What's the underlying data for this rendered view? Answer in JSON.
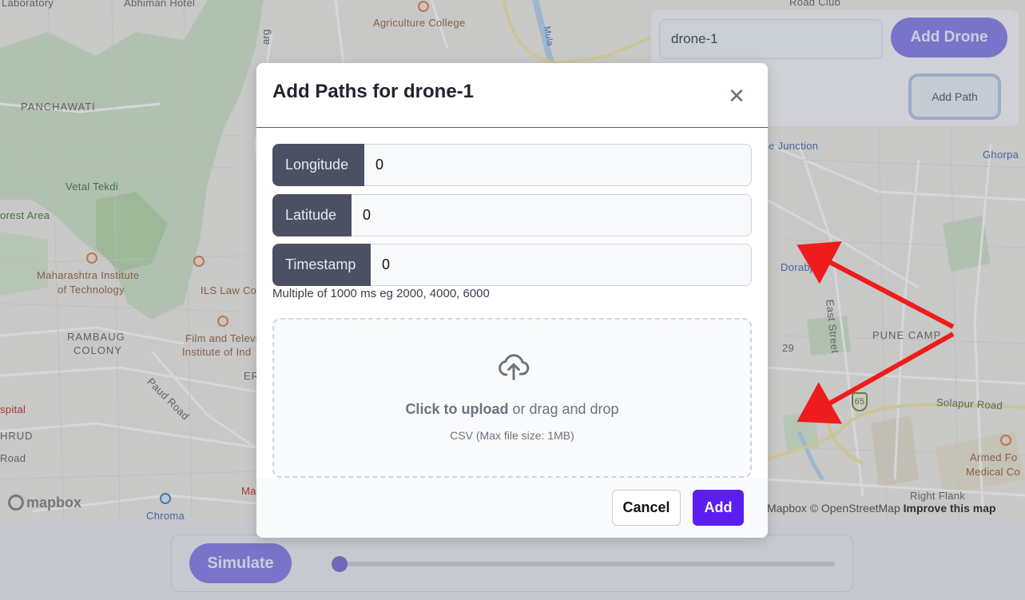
{
  "map": {
    "labels": {
      "laboratory": "Laboratory",
      "abhiman_hotel": "Abhiman Hotel",
      "agriculture_college": "Agriculture College",
      "panchawati": "PANCHAWATI",
      "vetal_tekdi": "Vetal Tekdi",
      "forest_area": "orest Area",
      "maharashtra_institute_1": "Maharashtra Institute",
      "maharashtra_institute_2": "of Technology",
      "ils_law": "ILS Law Co",
      "rambaug_1": "RAMBAUG",
      "rambaug_2": "COLONY",
      "film_1": "Film and Televi",
      "film_2": "Institute of Ind",
      "paud_road": "Paud Road",
      "hospital": "spital",
      "hrud": "HRUD",
      "road": "Road",
      "chroma": "Chroma",
      "ma": "Ma",
      "er": "ER",
      "junction": "e Junction",
      "ghorpad": "Ghorpa",
      "dorabjee": "Dorabjee",
      "east_street": "East Street",
      "pune_camp": "PUNE CAMP",
      "num_29": "29",
      "num_65": "65",
      "solapur_road": "Solapur Road",
      "armed_forces_1": "Armed Fo",
      "armed_forces_2": "Medical Co",
      "right_flank": "Right Flank",
      "road_club": "Road Club",
      "marg": "arg",
      "mula": "Mula"
    },
    "logo": "mapbox",
    "attribution": {
      "text": "Mapbox © OpenStreetMap",
      "improve": "Improve this map"
    }
  },
  "drone_panel": {
    "drone_name_value": "drone-1",
    "add_drone_label": "Add Drone",
    "add_path_label": "Add Path"
  },
  "sim_bar": {
    "simulate_label": "Simulate",
    "progress": 0
  },
  "modal": {
    "title": "Add Paths for drone-1",
    "close_glyph": "✕",
    "fields": {
      "longitude": {
        "label": "Longitude",
        "value": "0"
      },
      "latitude": {
        "label": "Latitude",
        "value": "0"
      },
      "timestamp": {
        "label": "Timestamp",
        "value": "0"
      }
    },
    "timestamp_hint": "Multiple of 1000 ms eg 2000, 4000, 6000",
    "upload": {
      "icon": "cloud-upload-icon",
      "click_text": "Click to upload",
      "drag_text": " or drag and drop",
      "sub_text": "CSV (Max file size: 1MB)"
    },
    "cancel_label": "Cancel",
    "add_label": "Add"
  },
  "colors": {
    "primary": "#5b1ef0",
    "accent_muted": "#8a84e8",
    "field_label_bg": "#4b5163",
    "annotation_arrow": "#ee1c1c"
  }
}
